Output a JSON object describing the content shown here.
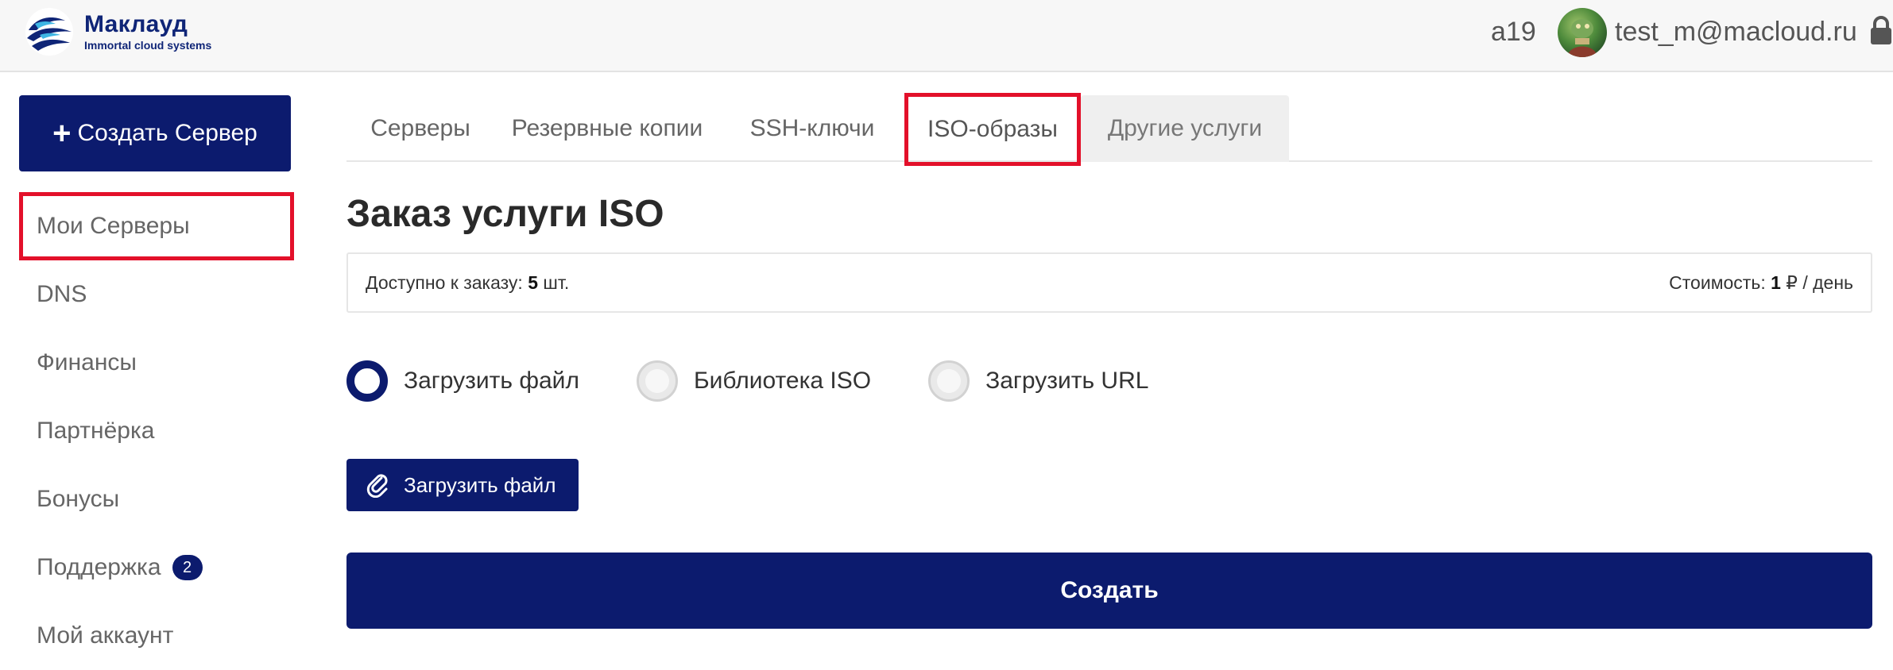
{
  "header": {
    "brand_title": "Маклауд",
    "brand_subtitle": "Immortal cloud systems",
    "user_id": "a19",
    "user_email": "test_m@macloud.ru",
    "icons": {
      "logo": "macloud-logo-icon",
      "avatar": "user-avatar",
      "lock": "lock-icon"
    }
  },
  "sidebar": {
    "create_label": "Создать Сервер",
    "create_icon": "plus-icon",
    "items": [
      {
        "label": "Мои Серверы",
        "active": true
      },
      {
        "label": "DNS"
      },
      {
        "label": "Финансы"
      },
      {
        "label": "Партнёрка"
      },
      {
        "label": "Бонусы"
      },
      {
        "label": "Поддержка",
        "badge": "2"
      },
      {
        "label": "Мой аккаунт"
      }
    ]
  },
  "tabs": [
    {
      "label": "Серверы"
    },
    {
      "label": "Резервные копии"
    },
    {
      "label": "SSH-ключи"
    },
    {
      "label": "ISO-образы",
      "highlighted": true
    },
    {
      "label": "Другие услуги",
      "selected": true
    }
  ],
  "main": {
    "title": "Заказ услуги ISO",
    "available_prefix": "Доступно к заказу:",
    "available_count": "5",
    "available_suffix": "шт.",
    "cost_prefix": "Стоимость:",
    "cost_value": "1",
    "cost_suffix": "₽ / день",
    "radio_options": [
      {
        "label": "Загрузить файл",
        "checked": true
      },
      {
        "label": "Библиотека ISO",
        "checked": false
      },
      {
        "label": "Загрузить URL",
        "checked": false
      }
    ],
    "upload_label": "Загрузить файл",
    "upload_icon": "paperclip-icon",
    "submit_label": "Создать"
  },
  "colors": {
    "primary": "#0c1b6e",
    "highlight_border": "#e3102a",
    "header_bg": "#f7f7f7",
    "tab_selected_bg": "#efefef"
  }
}
